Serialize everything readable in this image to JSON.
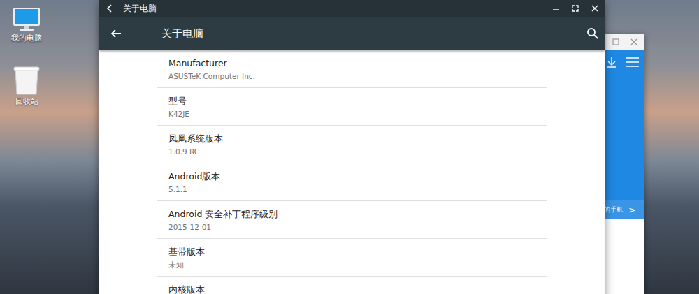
{
  "desktop": {
    "icons": [
      {
        "label": "我的电脑",
        "kind": "computer"
      },
      {
        "label": "回收站",
        "kind": "trash"
      }
    ]
  },
  "window": {
    "title": "关于电脑",
    "toolbar_title": "关于电脑"
  },
  "items": [
    {
      "label": "Manufacturer",
      "value": "ASUSTeK Computer Inc."
    },
    {
      "label": "型号",
      "value": "K42JE"
    },
    {
      "label": "凤凰系统版本",
      "value": "1.0.9 RC"
    },
    {
      "label": "Android版本",
      "value": "5.1.1"
    },
    {
      "label": "Android 安全补丁程序级别",
      "value": "2015-12-01"
    },
    {
      "label": "基带版本",
      "value": "未知"
    },
    {
      "label": "内核版本"
    }
  ],
  "background_window": {
    "banner_text": "的手机",
    "banner_arrow": ">"
  }
}
